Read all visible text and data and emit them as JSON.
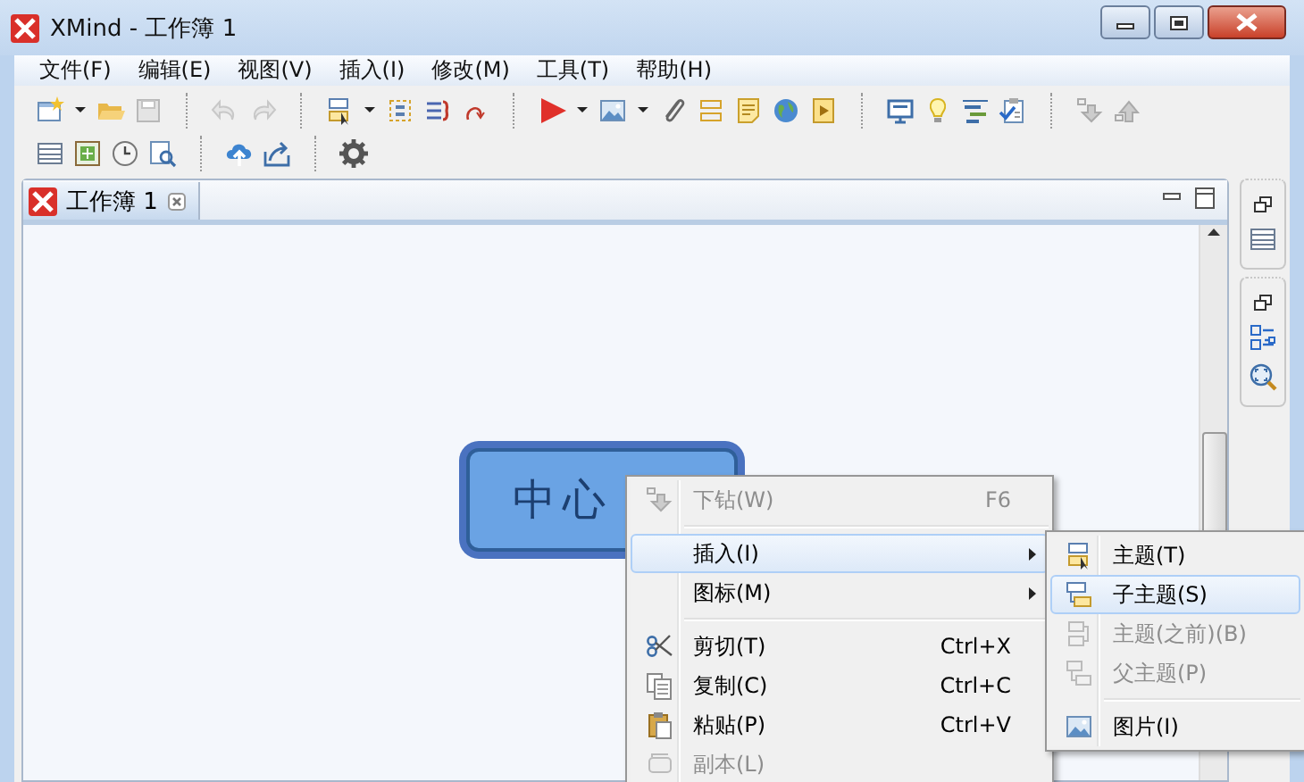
{
  "window": {
    "title": "XMind - 工作簿 1"
  },
  "menu_bar": [
    "文件(F)",
    "编辑(E)",
    "视图(V)",
    "插入(I)",
    "修改(M)",
    "工具(T)",
    "帮助(H)"
  ],
  "editor": {
    "tabs": [
      {
        "label": "工作簿 1",
        "selected": true
      }
    ]
  },
  "canvas": {
    "central_topic": {
      "text": "中心",
      "selected": true
    }
  },
  "context_menu": {
    "items": [
      {
        "kind": "item",
        "label": "下钻(W)",
        "shortcut": "F6",
        "disabled": true,
        "selected": false,
        "has_submenu": false
      },
      {
        "kind": "separator"
      },
      {
        "kind": "item",
        "label": "插入(I)",
        "disabled": false,
        "selected": true,
        "has_submenu": true
      },
      {
        "kind": "item",
        "label": "图标(M)",
        "disabled": false,
        "selected": false,
        "has_submenu": true
      },
      {
        "kind": "separator"
      },
      {
        "kind": "item",
        "label": "剪切(T)",
        "shortcut": "Ctrl+X",
        "disabled": false,
        "selected": false,
        "has_submenu": false
      },
      {
        "kind": "item",
        "label": "复制(C)",
        "shortcut": "Ctrl+C",
        "disabled": false,
        "selected": false,
        "has_submenu": false
      },
      {
        "kind": "item",
        "label": "粘贴(P)",
        "shortcut": "Ctrl+V",
        "disabled": false,
        "selected": false,
        "has_submenu": false
      },
      {
        "kind": "item",
        "label": "副本(L)",
        "disabled": true,
        "selected": false,
        "has_submenu": false
      }
    ]
  },
  "submenu": {
    "items": [
      {
        "kind": "item",
        "label": "主题(T)",
        "disabled": false,
        "selected": false
      },
      {
        "kind": "item",
        "label": "子主题(S)",
        "disabled": false,
        "selected": true
      },
      {
        "kind": "item",
        "label": "主题(之前)(B)",
        "disabled": true,
        "selected": false
      },
      {
        "kind": "item",
        "label": "父主题(P)",
        "disabled": true,
        "selected": false
      },
      {
        "kind": "separator"
      },
      {
        "kind": "item",
        "label": "图片(I)",
        "disabled": false,
        "selected": false
      }
    ]
  }
}
